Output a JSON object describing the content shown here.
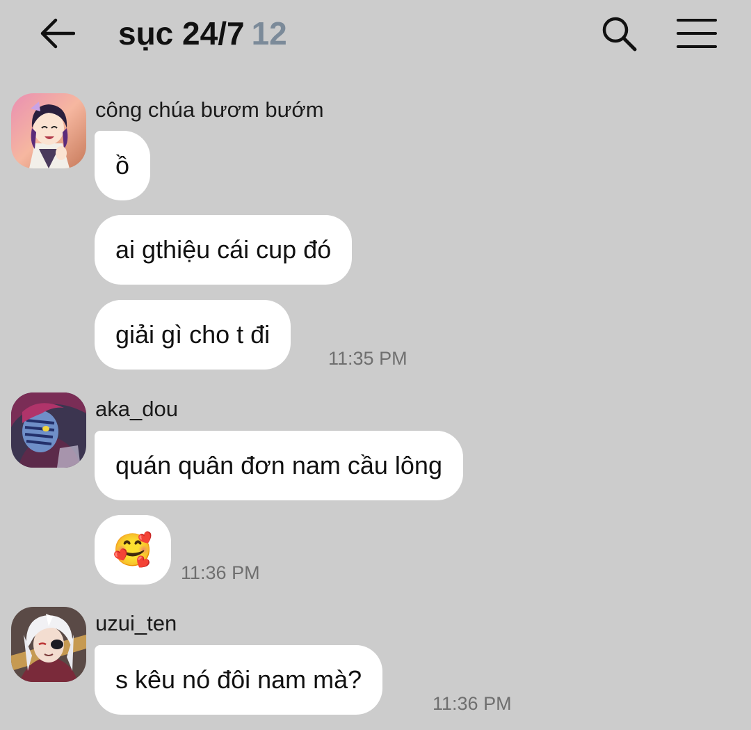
{
  "header": {
    "title": "sục 24/7",
    "member_count": "12",
    "back_icon": "back-arrow-icon",
    "search_icon": "search-icon",
    "menu_icon": "hamburger-menu-icon"
  },
  "groups": [
    {
      "sender": "công chúa bươm bướm",
      "avatar": "anime-avatar-purple-hair",
      "messages": [
        "ồ",
        "ai gthiệu cái cup đó",
        "giải gì cho t đi"
      ],
      "time": "11:35 PM"
    },
    {
      "sender": "aka_dou",
      "avatar": "anime-avatar-red-hair-markings",
      "messages": [
        "quán quân đơn nam cầu lông",
        "🥰"
      ],
      "time": "11:36 PM"
    },
    {
      "sender": "uzui_ten",
      "avatar": "anime-avatar-white-hair",
      "messages": [
        "s kêu nó đôi nam mà?"
      ],
      "time": "11:36 PM"
    }
  ],
  "colors": {
    "background": "#cccccc",
    "bubble": "#ffffff",
    "count": "#7b8a99",
    "timestamp": "#6f6f6f"
  }
}
